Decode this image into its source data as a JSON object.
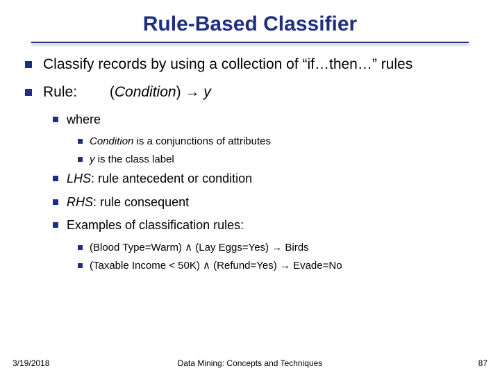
{
  "title": "Rule-Based Classifier",
  "b1": {
    "p1": "Classify records by using a collection of “if…then…” rules",
    "p2_label": "Rule:",
    "p2_cond_open": "(",
    "p2_cond": "Condition",
    "p2_cond_close": ")",
    "p2_arrow": " → ",
    "p2_y": "y"
  },
  "b2": {
    "where": "where",
    "lhs_pre": "LHS",
    "lhs_post": ": rule antecedent or condition",
    "rhs_pre": "RHS",
    "rhs_post": ": rule consequent",
    "examples": "Examples of classification rules:"
  },
  "b3a": {
    "c1_pre": "Condition",
    "c1_post": " is a conjunctions of attributes",
    "c2_pre": "y",
    "c2_post": " is the class label"
  },
  "b3b": {
    "e1": "(Blood Type=Warm) ∧ (Lay Eggs=Yes) → Birds",
    "e2": "(Taxable Income < 50K) ∧ (Refund=Yes) → Evade=No"
  },
  "footer": {
    "date": "3/19/2018",
    "center": "Data Mining: Concepts and Techniques",
    "page": "87"
  }
}
